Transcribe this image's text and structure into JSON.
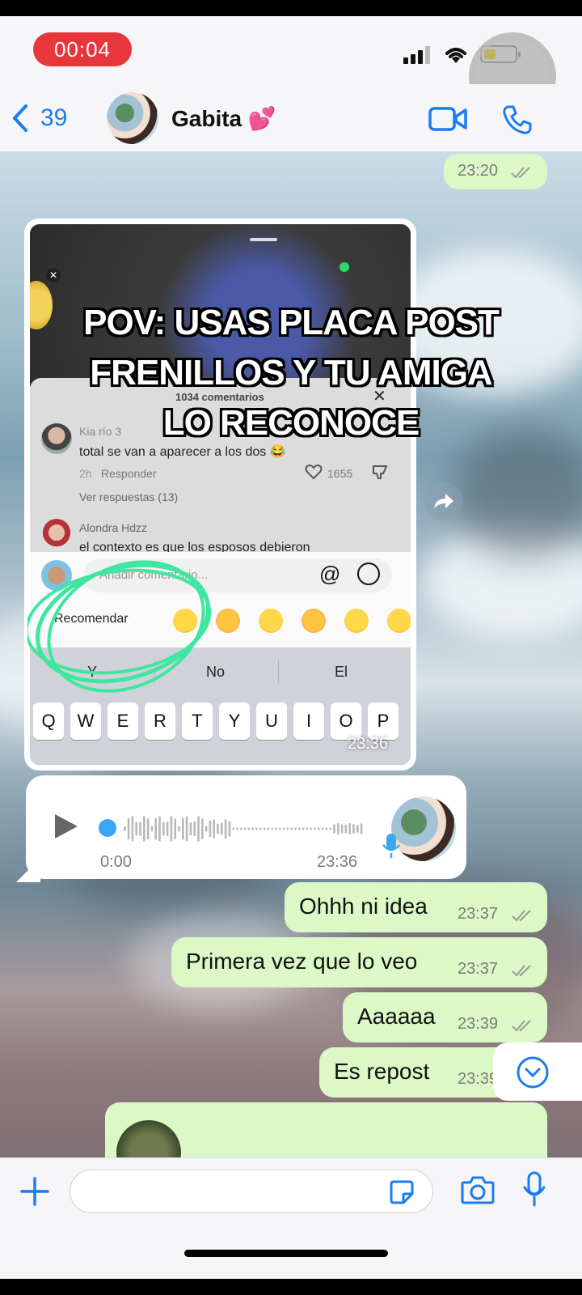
{
  "status_bar": {
    "recording_time": "00:04"
  },
  "header": {
    "back_count": "39",
    "contact_name": "Gabita 💕"
  },
  "messages": {
    "first_time": "23:20",
    "shared_screenshot": {
      "overlay_text_line1": "POV: USAS PLACA POST",
      "overlay_text_line2": "FRENILLOS Y TU AMIGA",
      "overlay_text_line3": "LO RECONOCE",
      "comments_header": "1034 comentarios",
      "comment1_user": "Kia río 3",
      "comment1_text": "total se van a aparecer a los dos 😂",
      "comment1_age": "2h",
      "comment1_reply": "Responder",
      "comment1_likes": "1655",
      "comment1_view_replies": "Ver respuestas (13)",
      "comment2_user": "Alondra Hdzz",
      "comment2_text": "el contexto es que los esposos debieron",
      "add_comment_placeholder": "Añadir comentario...",
      "recommend_label": "Recomendar",
      "predictions": [
        "Y",
        "No",
        "El"
      ],
      "keys": [
        "Q",
        "W",
        "E",
        "R",
        "T",
        "Y",
        "U",
        "I",
        "O",
        "P"
      ],
      "time": "23:36"
    },
    "voice_note": {
      "elapsed": "0:00",
      "time": "23:36"
    },
    "outgoing": [
      {
        "text": "Ohhh ni idea",
        "time": "23:37"
      },
      {
        "text": "Primera vez que lo veo",
        "time": "23:37"
      },
      {
        "text": "Aaaaaa",
        "time": "23:39"
      },
      {
        "text": "Es repost",
        "time": "23:39"
      }
    ]
  },
  "colors": {
    "accent_blue": "#1a7cf2",
    "outgoing_bubble": "#dbf8c6",
    "recording_red": "#e8363d",
    "highlight_green": "#3ee6a0"
  }
}
